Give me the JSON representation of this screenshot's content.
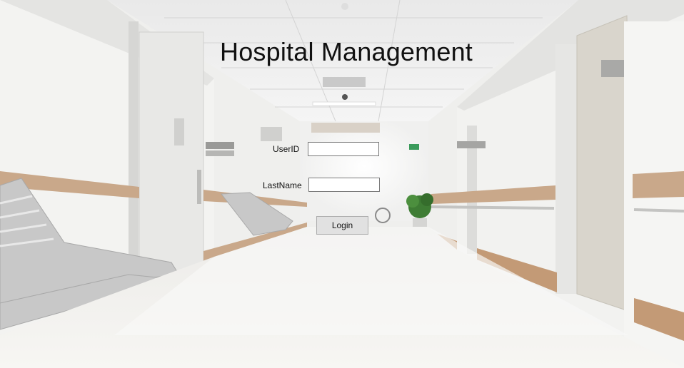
{
  "window": {
    "title": "Hospital Management"
  },
  "login": {
    "userid_label": "UserID",
    "userid_value": "",
    "lastname_label": "LastName",
    "lastname_value": "",
    "login_button_label": "Login"
  }
}
